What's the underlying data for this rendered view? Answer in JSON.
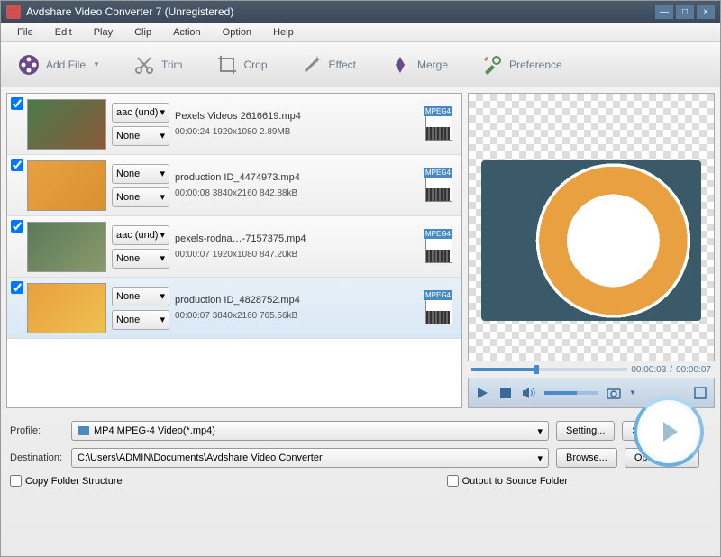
{
  "window": {
    "title": "Avdshare Video Converter 7 (Unregistered)"
  },
  "menu": {
    "file": "File",
    "edit": "Edit",
    "play": "Play",
    "clip": "Clip",
    "action": "Action",
    "option": "Option",
    "help": "Help"
  },
  "toolbar": {
    "addfile": "Add File",
    "trim": "Trim",
    "crop": "Crop",
    "effect": "Effect",
    "merge": "Merge",
    "preference": "Preference"
  },
  "files": [
    {
      "audio": "aac (und)",
      "sub": "None",
      "name": "Pexels Videos 2616619.mp4",
      "meta": "00:00:24  1920x1080 2.89MB",
      "fmt": "MPEG4"
    },
    {
      "audio": "None",
      "sub": "None",
      "name": "production ID_4474973.mp4",
      "meta": "00:00:08  3840x2160 842.88kB",
      "fmt": "MPEG4"
    },
    {
      "audio": "aac (und)",
      "sub": "None",
      "name": "pexels-rodna…-7157375.mp4",
      "meta": "00:00:07  1920x1080 847.20kB",
      "fmt": "MPEG4"
    },
    {
      "audio": "None",
      "sub": "None",
      "name": "production ID_4828752.mp4",
      "meta": "00:00:07  3840x2160 765.56kB",
      "fmt": "MPEG4"
    }
  ],
  "preview": {
    "current": "00:00:03",
    "total": "00:00:07"
  },
  "profile": {
    "label": "Profile:",
    "value": "MP4 MPEG-4 Video(*.mp4)",
    "setting": "Setting...",
    "saveas": "Save As..."
  },
  "dest": {
    "label": "Destination:",
    "value": "C:\\Users\\ADMIN\\Documents\\Avdshare Video Converter",
    "browse": "Browse...",
    "open": "Open Folder"
  },
  "opts": {
    "copyfolder": "Copy Folder Structure",
    "outsource": "Output to Source Folder"
  }
}
